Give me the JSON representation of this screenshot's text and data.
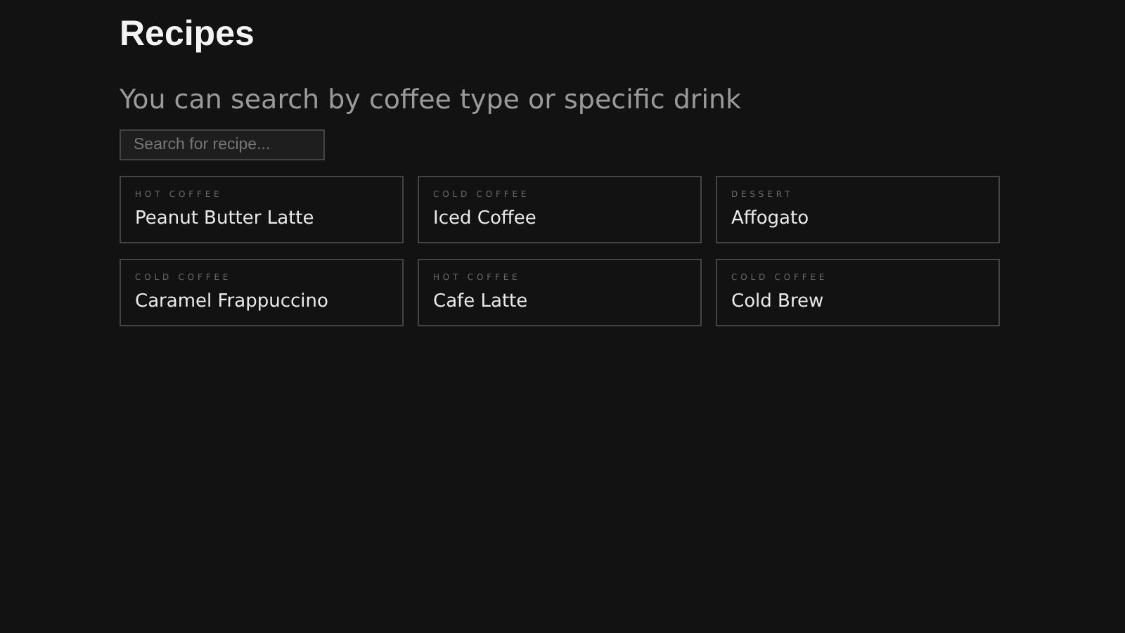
{
  "title": "Recipes",
  "subtitle": "You can search by coffee type or specific drink",
  "search": {
    "placeholder": "Search for recipe..."
  },
  "recipes": [
    {
      "category": "HOT COFFEE",
      "name": "Peanut Butter Latte"
    },
    {
      "category": "COLD COFFEE",
      "name": "Iced Coffee"
    },
    {
      "category": "DESSERT",
      "name": "Affogato"
    },
    {
      "category": "COLD COFFEE",
      "name": "Caramel Frappuccino"
    },
    {
      "category": "HOT COFFEE",
      "name": "Cafe Latte"
    },
    {
      "category": "COLD COFFEE",
      "name": "Cold Brew"
    }
  ]
}
